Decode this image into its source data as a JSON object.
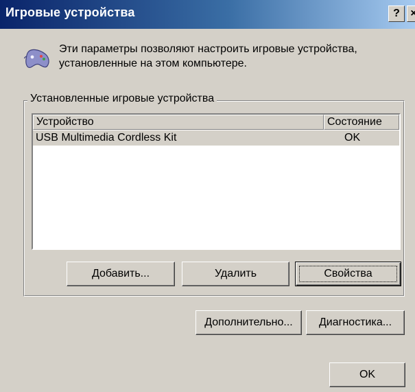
{
  "window": {
    "title": "Игровые устройства",
    "help_button": "?",
    "close_button": "×"
  },
  "info": {
    "icon": "gamepad-icon",
    "text": "Эти параметры позволяют настроить игровые устройства, установленные на этом компьютере."
  },
  "group": {
    "legend": "Установленные игровые устройства"
  },
  "list": {
    "columns": [
      "Устройство",
      "Состояние"
    ],
    "rows": [
      {
        "device": "USB Multimedia Cordless Kit",
        "status": "OK"
      }
    ]
  },
  "buttons": {
    "add": "Добавить...",
    "remove": "Удалить",
    "properties": "Свойства",
    "advanced": "Дополнительно...",
    "diagnostics": "Диагностика...",
    "ok": "OK"
  },
  "colors": {
    "title_gradient_start": "#0a246a",
    "title_gradient_end": "#a6caf0",
    "dialog_face": "#d4d0c8"
  }
}
